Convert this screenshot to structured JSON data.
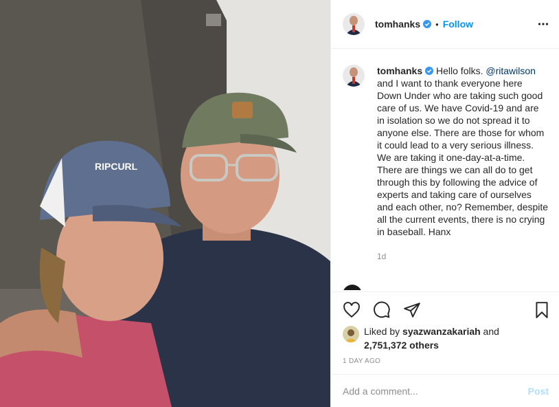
{
  "post": {
    "username": "tomhanks",
    "follow_label": "Follow",
    "separator": "•",
    "caption_user": "tomhanks",
    "caption_pre": " Hello folks. ",
    "caption_mention": "@ritawilson",
    "caption_post": " and I want to thank everyone here Down Under who are taking such good care of us. We have Covid-19 and are in isolation so we do not spread it to anyone else. There are those for whom it could lead to a very serious illness. We are taking it one-day-at-a-time. There are things we can all do to get through this by following the advice of experts and taking care of ourselves and each other, no? Remember, despite all the current events, there is no crying in baseball. Hanx",
    "caption_time": "1d",
    "liked_by_prefix": "Liked by ",
    "liked_by_user": "syazwanzakariah",
    "liked_by_and": " and",
    "liked_by_count": "2,751,372 others",
    "posted_time": "1 DAY AGO",
    "comment_placeholder": "Add a comment...",
    "post_label": "Post"
  },
  "photo": {
    "cap_text": "RIPCURL"
  },
  "icons": {
    "verified": "verified-badge-icon",
    "more": "more-options-icon",
    "like": "heart-icon",
    "comment": "comment-bubble-icon",
    "share": "paper-plane-icon",
    "save": "bookmark-icon"
  },
  "colors": {
    "accent": "#0095f6",
    "text": "#262626",
    "muted": "#8e8e8e",
    "border": "#efefef",
    "post_disabled": "#b2dffc"
  }
}
